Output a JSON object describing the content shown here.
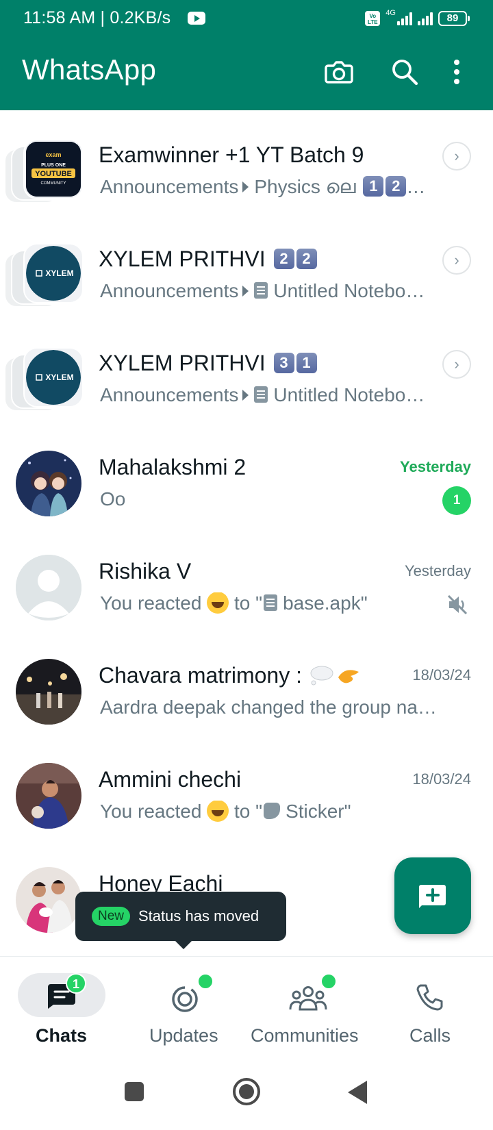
{
  "status_bar": {
    "time_speed": "11:58 AM | 0.2KB/s",
    "network": "4G",
    "volte": "Vo LTE",
    "battery": "89"
  },
  "header": {
    "title": "WhatsApp",
    "icons": [
      "camera-icon",
      "search-icon",
      "more-vert-icon"
    ]
  },
  "chats": [
    {
      "name": "Examwinner +1 YT Batch 9",
      "sub": "Announcements",
      "preview": "Physics ലെ",
      "keycaps": [
        "1",
        "2"
      ],
      "trailing": "…",
      "type": "community",
      "avatar_label": "PLUS ONE YOUTUBE COMMUNITY"
    },
    {
      "name": "XYLEM PRITHVI",
      "name_keycaps": [
        "2",
        "2"
      ],
      "sub": "Announcements",
      "preview": "Untitled Notebo…",
      "type": "community",
      "avatar_label": "XYLEM"
    },
    {
      "name": "XYLEM PRITHVI",
      "name_keycaps": [
        "3",
        "1"
      ],
      "sub": "Announcements",
      "preview": "Untitled Notebo…",
      "type": "community",
      "avatar_label": "XYLEM"
    },
    {
      "name": "Mahalakshmi 2",
      "preview": "Oo",
      "time": "Yesterday",
      "unread": "1"
    },
    {
      "name": "Rishika V",
      "preview_a": "You reacted",
      "preview_b": "to \"",
      "preview_c": "base.apk\"",
      "time": "Yesterday",
      "muted": true
    },
    {
      "name": "Chavara matrimony :",
      "preview": "Aardra deepak changed the group na…",
      "time": "18/03/24"
    },
    {
      "name": "Ammini chechi",
      "preview_a": "You reacted",
      "preview_b": "to \"",
      "preview_c": "Sticker\"",
      "time": "18/03/24"
    },
    {
      "name": "Honey Eachi"
    }
  ],
  "toast": {
    "badge": "New",
    "text": "Status has moved"
  },
  "fab": {
    "icon": "new-chat-icon"
  },
  "bottom_nav": [
    {
      "label": "Chats",
      "badge": "1",
      "active": true
    },
    {
      "label": "Updates"
    },
    {
      "label": "Communities"
    },
    {
      "label": "Calls"
    }
  ],
  "colors": {
    "brand": "#008069",
    "accent": "#25d366",
    "muted_text": "#667781"
  }
}
